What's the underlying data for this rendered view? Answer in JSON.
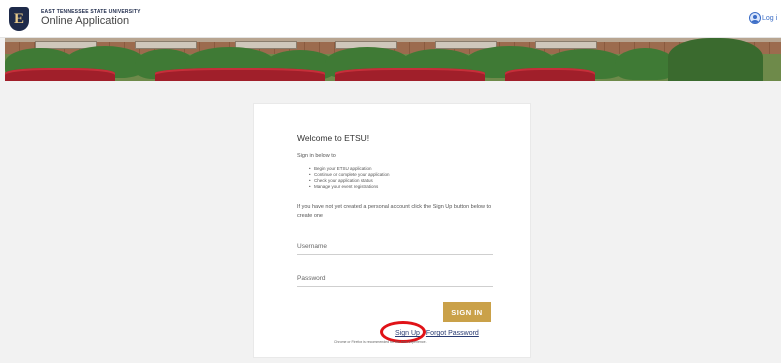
{
  "header": {
    "logo_letter": "E",
    "university_name": "EAST TENNESSEE STATE UNIVERSITY",
    "app_title": "Online Application",
    "login_label": "Log i"
  },
  "login_card": {
    "welcome": "Welcome to ETSU!",
    "sign_in_below": "Sign in below to",
    "bullets": [
      "Begin your ETSU application",
      "Continue or complete your application",
      "Check your application status",
      "Manage your event registrations"
    ],
    "info": "If you have not yet created a personal account click the Sign Up button below to create one",
    "username_placeholder": "Username",
    "password_placeholder": "Password",
    "sign_in_button": "SIGN IN",
    "sign_up_link": "Sign Up",
    "forgot_password_link": "Forgot Password",
    "browser_note": "Chrome or Firefox is recommended for the best experience."
  },
  "colors": {
    "brand_navy": "#1e2a4a",
    "brand_gold": "#caa149",
    "annotation_red": "#e01217",
    "link_blue": "#3a6cc6"
  }
}
